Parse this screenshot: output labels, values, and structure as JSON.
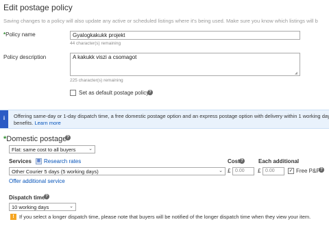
{
  "page": {
    "title": "Edit postage policy",
    "subtitle": "Saving changes to a policy will also update any active or scheduled listings where it's being used. Make sure you know which listings will b"
  },
  "policy": {
    "name_label": "Policy name",
    "name_value": "Gyalogkakukk projekt",
    "name_hint": "44 character(s) remaining",
    "desc_label": "Policy description",
    "desc_value": "A kakukk viszi a csomagot",
    "desc_hint": "225 character(s) remaining",
    "default_label": "Set as default postage policy"
  },
  "banner": {
    "line1": "Offering same-day or 1-day dispatch time, a free domestic postage option and an express postage option with delivery within 1 working day he",
    "line2_prefix": "benefits.",
    "learn_more": "Learn more"
  },
  "domestic": {
    "title": "Domestic postage",
    "cost_type": "Flat: same cost to all buyers",
    "services_label": "Services",
    "research_rates": "Research rates",
    "cost_label": "Cost",
    "each_additional_label": "Each additional",
    "service_value": "Other Courier 5 days (5 working days)",
    "currency": "£",
    "cost_value": "0.00",
    "additional_value": "0.00",
    "free_pp_label": "Free P&P",
    "offer_additional": "Offer additional service"
  },
  "dispatch": {
    "label": "Dispatch time",
    "value": "10 working days",
    "warning": "If you select a longer dispatch time, please note that buyers will be notified of the longer dispatch time when they view your item."
  },
  "icons": {
    "help": "question-circle-icon",
    "info": "info-icon",
    "research": "calculator-icon",
    "warning": "warning-icon",
    "chevron": "chevron-down-icon"
  },
  "colors": {
    "required_star": "#2b8a2b",
    "link": "#0654ba",
    "banner_bg": "#e9f2fc",
    "banner_bar": "#2c5cc5",
    "warning": "#f5a623"
  }
}
